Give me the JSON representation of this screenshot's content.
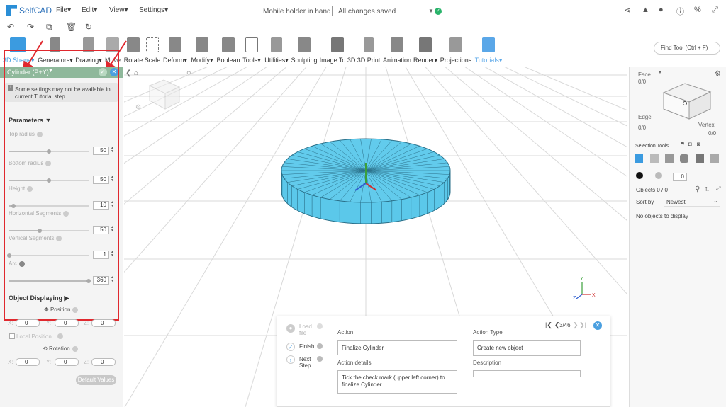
{
  "app": {
    "logo_text": "SelfCAD"
  },
  "menu": [
    "File▾",
    "Edit▾",
    "View▾",
    "Settings▾"
  ],
  "document": {
    "name": "Mobile holder in hand",
    "status": "All changes saved"
  },
  "top_icons": [
    "share-icon",
    "bell-icon",
    "user-icon",
    "info-icon",
    "percent-icon",
    "expand-icon"
  ],
  "toolbar": {
    "tools": [
      {
        "label": "3D Shape▾",
        "color": "#3b9be0"
      },
      {
        "label": "Generators▾",
        "color": "#777777"
      },
      {
        "label": "Drawing▾",
        "color": "#777777"
      },
      {
        "label": "Move",
        "color": "#777777"
      },
      {
        "label": "Rotate",
        "color": "#777777"
      },
      {
        "label": "Scale",
        "color": "#777777"
      },
      {
        "label": "Deform▾",
        "color": "#777777"
      },
      {
        "label": "Modify▾",
        "color": "#777777"
      },
      {
        "label": "Boolean",
        "color": "#777777"
      },
      {
        "label": "Tools▾",
        "color": "#777777"
      },
      {
        "label": "Utilities▾",
        "color": "#777777"
      },
      {
        "label": "Sculpting",
        "color": "#777777"
      },
      {
        "label": "Image To 3D",
        "color": "#777777"
      },
      {
        "label": "3D Print",
        "color": "#777777"
      },
      {
        "label": "Animation",
        "color": "#777777"
      },
      {
        "label": "Render▾",
        "color": "#777777"
      },
      {
        "label": "Projections",
        "color": "#777777"
      },
      {
        "label": "Tutorials▾",
        "color": "#5aa7e8"
      }
    ],
    "find_tool": "Find Tool (Ctrl + F)"
  },
  "left_panel": {
    "title": "Cylinder (P+Y)",
    "notice": "Some settings may not be available in current Tutorial step",
    "parameters_title": "Parameters",
    "params": [
      {
        "label": "Top radius",
        "value": "50",
        "fraction": 0.5
      },
      {
        "label": "Bottom radius",
        "value": "50",
        "fraction": 0.5
      },
      {
        "label": "Height",
        "value": "10",
        "fraction": 0.05
      },
      {
        "label": "Horizontal Segments",
        "value": "50",
        "fraction": 0.38
      },
      {
        "label": "Vertical Segments",
        "value": "1",
        "fraction": 0.0
      },
      {
        "label": "Arc",
        "value": "360",
        "fraction": 1.0
      }
    ],
    "object_displaying": "Object Displaying",
    "position_label": "Position",
    "rotation_label": "Rotation",
    "local_position": "Local Position",
    "axes": [
      "X:",
      "Y:",
      "Z:"
    ],
    "position_values": [
      "0",
      "0",
      "0"
    ],
    "rotation_values": [
      "0",
      "0",
      "0"
    ],
    "default_values": "Default Values"
  },
  "right_panel": {
    "face": "Face",
    "face_count": "0/0",
    "edge": "Edge",
    "edge_count": "0/0",
    "vertex": "Vertex",
    "vertex_count": "0/0",
    "selection_tools": "Selection Tools",
    "brush_size": "0",
    "objects": "Objects 0 / 0",
    "sort_by": "Sort by",
    "sort_value": "Newest",
    "empty": "No objects to display"
  },
  "tutorial": {
    "steps": [
      {
        "label": "Load file",
        "state": "pending"
      },
      {
        "label": "Finish",
        "state": "done"
      },
      {
        "label": "Next Step",
        "state": "next"
      }
    ],
    "action_label": "Action",
    "action_value": "Finalize Cylinder",
    "action_details_label": "Action details",
    "action_details_value": "Tick the check mark (upper left corner) to finalize Cylinder",
    "action_type_label": "Action Type",
    "action_type_value": "Create new object",
    "description_label": "Description",
    "description_value": "",
    "progress": "3/46"
  },
  "colors": {
    "accent": "#3b9be0",
    "cylinder": "#5bc8ea",
    "panel_header": "#8fb89b",
    "highlight_box": "#e0282e",
    "success": "#29b36a"
  }
}
